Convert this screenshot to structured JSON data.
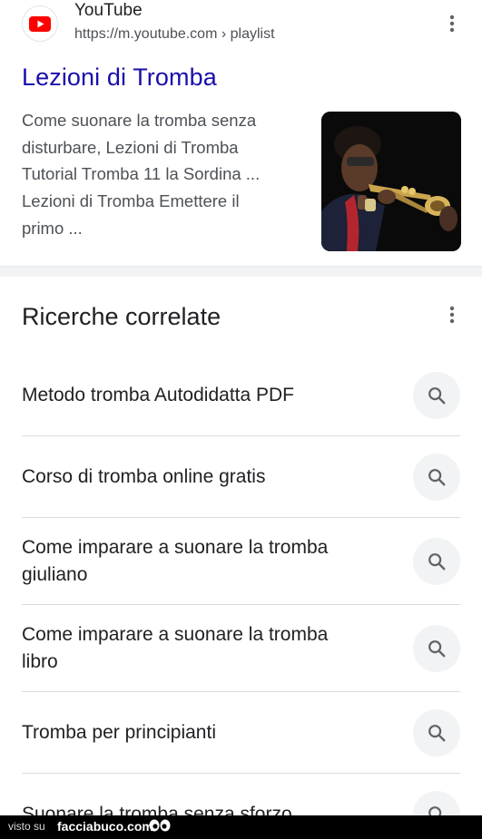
{
  "result": {
    "site_name": "YouTube",
    "url": "https://m.youtube.com",
    "breadcrumb": "› playlist",
    "title": "Lezioni di Tromba",
    "snippet_lines": [
      "Come suonare la tromba senza",
      "disturbare, Lezioni di Tromba",
      "Tutorial Tromba 11 la Sordina ...",
      "Lezioni di Tromba Emettere il",
      "primo ..."
    ],
    "favicon_icon": "youtube-logo-icon",
    "more_icon": "more-vert-icon"
  },
  "related": {
    "heading": "Ricerche correlate",
    "items": [
      {
        "lines": [
          "Metodo tromba Autodidatta PDF"
        ]
      },
      {
        "lines": [
          "Corso di tromba online gratis"
        ]
      },
      {
        "lines": [
          "Come imparare a suonare la tromba",
          "giuliano"
        ]
      },
      {
        "lines": [
          "Come imparare a suonare la tromba",
          "libro"
        ]
      },
      {
        "lines": [
          "Tromba per principianti"
        ]
      },
      {
        "lines": [
          "Suonare la tromba senza sforzo"
        ]
      }
    ],
    "search_icon": "search-icon"
  },
  "watermark": {
    "prefix": "visto su",
    "site": "facciabuco.com"
  },
  "colors": {
    "link": "#1a0dab",
    "youtube_red": "#ff0000",
    "secondary_text": "#4d5156",
    "chip_bg": "#f1f3f4"
  }
}
